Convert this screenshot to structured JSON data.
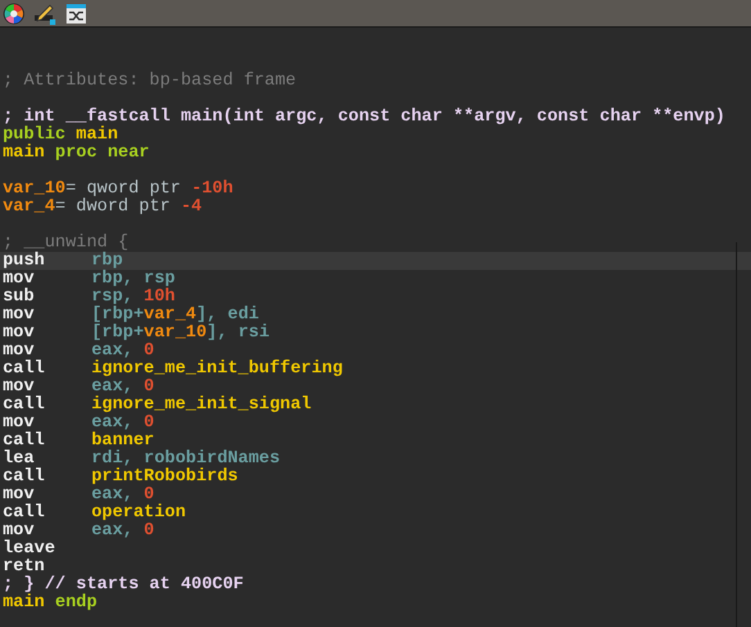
{
  "lines": [
    {
      "current": false,
      "gap_before": false,
      "tokens": [
        {
          "kind": "comment",
          "text": "; Attributes: bp-based frame"
        }
      ]
    },
    {
      "current": false,
      "gap_before": true,
      "tokens": [
        {
          "kind": "signature",
          "text": "; int __fastcall main(int argc, const char **argv, const char **envp)"
        }
      ]
    },
    {
      "current": false,
      "gap_before": false,
      "tokens": [
        {
          "kind": "keyword",
          "text": "public "
        },
        {
          "kind": "name",
          "text": "main"
        }
      ]
    },
    {
      "current": false,
      "gap_before": false,
      "tokens": [
        {
          "kind": "name",
          "text": "main "
        },
        {
          "kind": "keyword",
          "text": "proc near"
        }
      ]
    },
    {
      "current": false,
      "gap_before": true,
      "tokens": [
        {
          "kind": "var",
          "text": "var_10"
        },
        {
          "kind": "text",
          "text": "= qword ptr "
        },
        {
          "kind": "number",
          "text": "-10h"
        }
      ]
    },
    {
      "current": false,
      "gap_before": false,
      "tokens": [
        {
          "kind": "var",
          "text": "var_4"
        },
        {
          "kind": "text",
          "text": "= dword ptr "
        },
        {
          "kind": "number",
          "text": "-4"
        }
      ]
    },
    {
      "current": false,
      "gap_before": true,
      "tokens": [
        {
          "kind": "comment",
          "text": "; __unwind {"
        }
      ]
    },
    {
      "current": true,
      "gap_before": false,
      "tokens": [
        {
          "kind": "mnemonic",
          "text": "push"
        },
        {
          "kind": "register",
          "text": "rbp"
        }
      ]
    },
    {
      "current": false,
      "gap_before": false,
      "tokens": [
        {
          "kind": "mnemonic",
          "text": "mov"
        },
        {
          "kind": "register",
          "text": "rbp, rsp"
        }
      ]
    },
    {
      "current": false,
      "gap_before": false,
      "tokens": [
        {
          "kind": "mnemonic",
          "text": "sub"
        },
        {
          "kind": "register",
          "text": "rsp, "
        },
        {
          "kind": "number",
          "text": "10h"
        }
      ]
    },
    {
      "current": false,
      "gap_before": false,
      "tokens": [
        {
          "kind": "mnemonic",
          "text": "mov"
        },
        {
          "kind": "register",
          "text": "[rbp+"
        },
        {
          "kind": "var",
          "text": "var_4"
        },
        {
          "kind": "register",
          "text": "], edi"
        }
      ]
    },
    {
      "current": false,
      "gap_before": false,
      "tokens": [
        {
          "kind": "mnemonic",
          "text": "mov"
        },
        {
          "kind": "register",
          "text": "[rbp+"
        },
        {
          "kind": "var",
          "text": "var_10"
        },
        {
          "kind": "register",
          "text": "], rsi"
        }
      ]
    },
    {
      "current": false,
      "gap_before": false,
      "tokens": [
        {
          "kind": "mnemonic",
          "text": "mov"
        },
        {
          "kind": "register",
          "text": "eax, "
        },
        {
          "kind": "number",
          "text": "0"
        }
      ]
    },
    {
      "current": false,
      "gap_before": false,
      "tokens": [
        {
          "kind": "mnemonic",
          "text": "call"
        },
        {
          "kind": "name",
          "text": "ignore_me_init_buffering"
        }
      ]
    },
    {
      "current": false,
      "gap_before": false,
      "tokens": [
        {
          "kind": "mnemonic",
          "text": "mov"
        },
        {
          "kind": "register",
          "text": "eax, "
        },
        {
          "kind": "number",
          "text": "0"
        }
      ]
    },
    {
      "current": false,
      "gap_before": false,
      "tokens": [
        {
          "kind": "mnemonic",
          "text": "call"
        },
        {
          "kind": "name",
          "text": "ignore_me_init_signal"
        }
      ]
    },
    {
      "current": false,
      "gap_before": false,
      "tokens": [
        {
          "kind": "mnemonic",
          "text": "mov"
        },
        {
          "kind": "register",
          "text": "eax, "
        },
        {
          "kind": "number",
          "text": "0"
        }
      ]
    },
    {
      "current": false,
      "gap_before": false,
      "tokens": [
        {
          "kind": "mnemonic",
          "text": "call"
        },
        {
          "kind": "name",
          "text": "banner"
        }
      ]
    },
    {
      "current": false,
      "gap_before": false,
      "tokens": [
        {
          "kind": "mnemonic",
          "text": "lea"
        },
        {
          "kind": "register",
          "text": "rdi, robobirdNames"
        }
      ]
    },
    {
      "current": false,
      "gap_before": false,
      "tokens": [
        {
          "kind": "mnemonic",
          "text": "call"
        },
        {
          "kind": "name",
          "text": "printRobobirds"
        }
      ]
    },
    {
      "current": false,
      "gap_before": false,
      "tokens": [
        {
          "kind": "mnemonic",
          "text": "mov"
        },
        {
          "kind": "register",
          "text": "eax, "
        },
        {
          "kind": "number",
          "text": "0"
        }
      ]
    },
    {
      "current": false,
      "gap_before": false,
      "tokens": [
        {
          "kind": "mnemonic",
          "text": "call"
        },
        {
          "kind": "name",
          "text": "operation"
        }
      ]
    },
    {
      "current": false,
      "gap_before": false,
      "tokens": [
        {
          "kind": "mnemonic",
          "text": "mov"
        },
        {
          "kind": "register",
          "text": "eax, "
        },
        {
          "kind": "number",
          "text": "0"
        }
      ]
    },
    {
      "current": false,
      "gap_before": false,
      "tokens": [
        {
          "kind": "mnemonic",
          "text": "leave"
        }
      ]
    },
    {
      "current": false,
      "gap_before": false,
      "tokens": [
        {
          "kind": "mnemonic",
          "text": "retn"
        }
      ]
    },
    {
      "current": false,
      "gap_before": false,
      "tokens": [
        {
          "kind": "signature",
          "text": "; } // starts at 400C0F"
        }
      ]
    },
    {
      "current": false,
      "gap_before": false,
      "tokens": [
        {
          "kind": "name",
          "text": "main "
        },
        {
          "kind": "keyword",
          "text": "endp"
        }
      ]
    }
  ]
}
